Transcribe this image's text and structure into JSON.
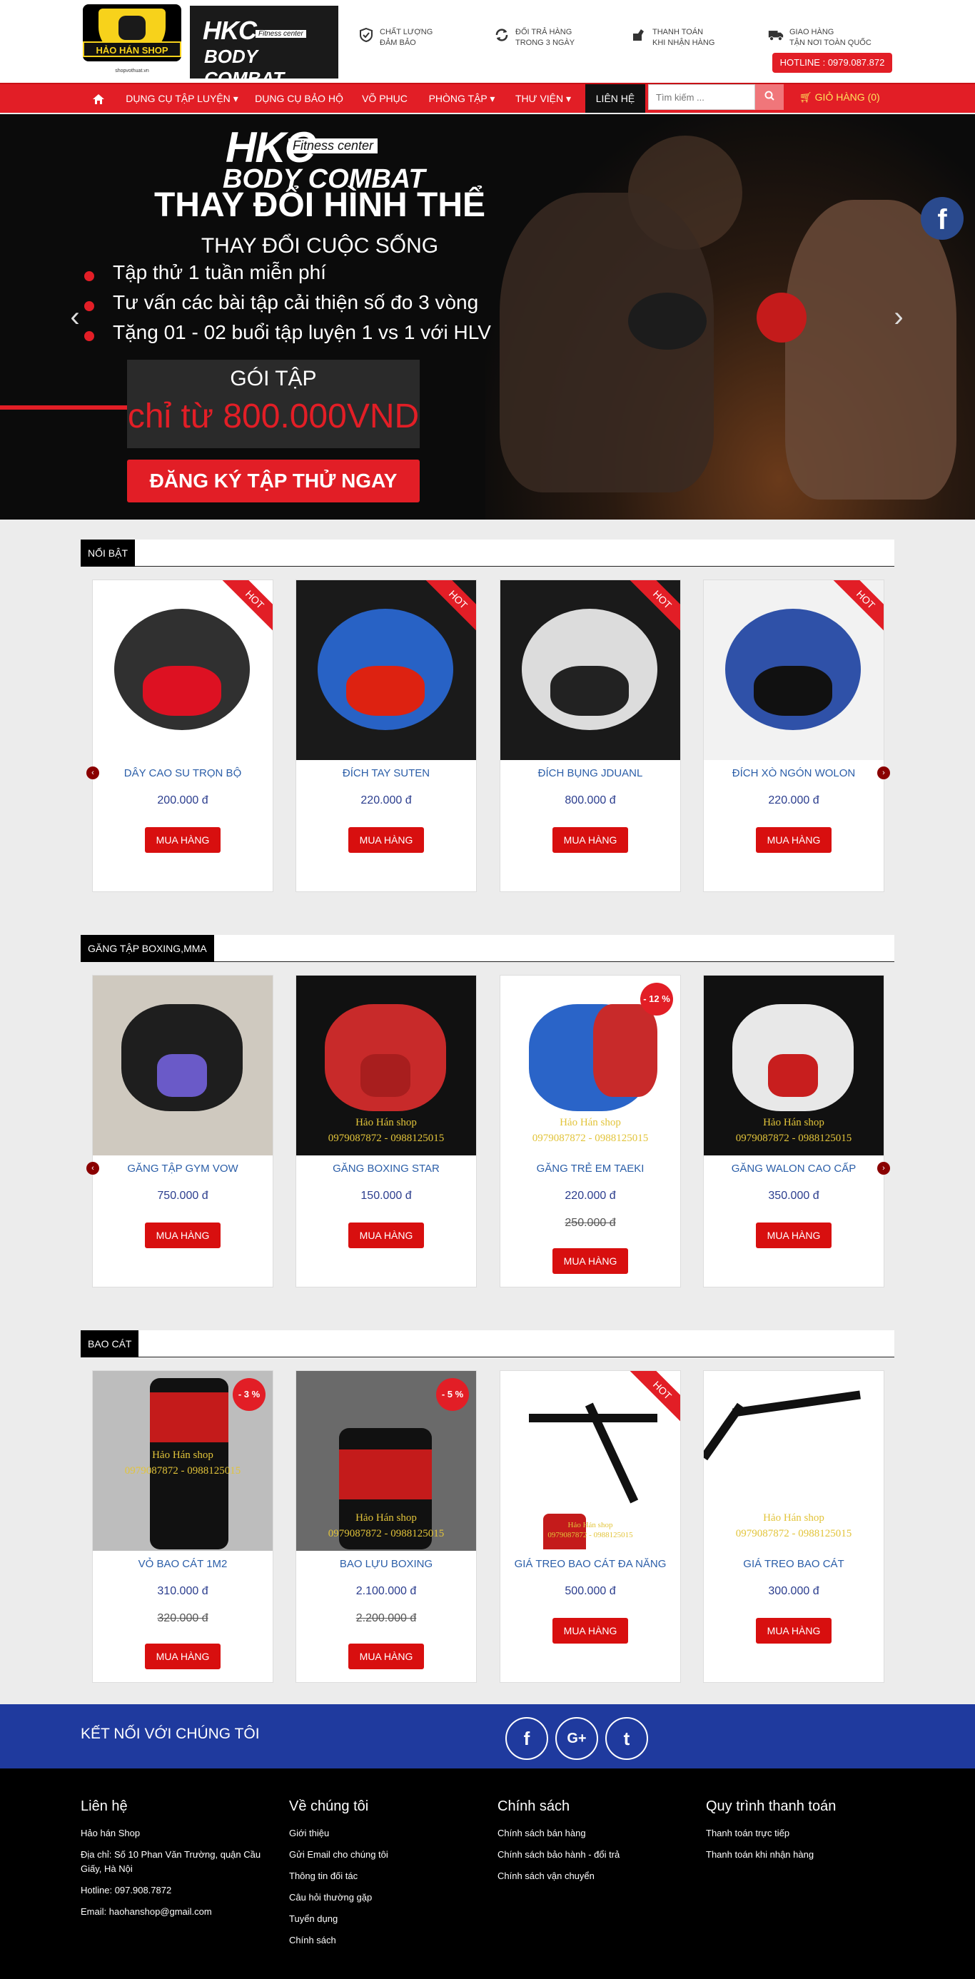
{
  "header": {
    "logo1_name": "HẢO HÁN SHOP",
    "logo1_sub": "shopvothuat.vn",
    "logo2_big": "HKC",
    "logo2_fit": "Fitness center",
    "logo2_bc": "BODY COMBAT",
    "features": [
      {
        "icon": "shield-icon",
        "line1": "Chất lượng",
        "line2": "đảm bảo"
      },
      {
        "icon": "refresh-icon",
        "line1": "Đổi trả hàng",
        "line2": "trong 3 ngày"
      },
      {
        "icon": "hand-cash-icon",
        "line1": "Thanh toán",
        "line2": "khi nhận hàng"
      },
      {
        "icon": "truck-icon",
        "line1": "Giao hàng",
        "line2": "tận nơi toàn quốc"
      }
    ],
    "hotline": "HOTLINE : 0979.087.872"
  },
  "nav": {
    "items": [
      "DỤNG CỤ TẬP LUYỆN",
      "DỤNG CỤ BẢO HỘ",
      "VÕ PHỤC",
      "PHÒNG TẬP",
      "THƯ VIỆN",
      "LIÊN HỆ"
    ],
    "search_placeholder": "Tìm kiếm ...",
    "cart": "GIỎ HÀNG (0)"
  },
  "banner": {
    "hkc": "HKC",
    "fit": "Fitness center",
    "bc": "BODY COMBAT",
    "h1": "THAY ĐỔI HÌNH THỂ",
    "h2": "THAY ĐỔI CUỘC SỐNG",
    "bullets": [
      "Tập thử 1 tuần miễn phí",
      "Tư vấn các bài tập cải thiện số đo 3 vòng",
      "Tặng 01 - 02 buổi tập luyện 1 vs 1 với HLV"
    ],
    "box_t1": "GÓI TẬP",
    "box_t2": "chỉ từ 800.000VND",
    "cta": "ĐĂNG KÝ TẬP THỬ NGAY"
  },
  "buy_label": "MUA HÀNG",
  "hot_label": "HOT",
  "watermark": [
    "Hảo Hán shop",
    "0979087872 - 0988125015"
  ],
  "sections": [
    {
      "title": "NỔI BẬT",
      "products": [
        {
          "name": "DÂY CAO SU TRỌN BỘ",
          "price": "200.000 đ",
          "old": "",
          "badge": "HOT"
        },
        {
          "name": "ĐÍCH TAY SUTEN",
          "price": "220.000 đ",
          "old": "",
          "badge": "HOT"
        },
        {
          "name": "ĐÍCH BỤNG JDUANL",
          "price": "800.000 đ",
          "old": "",
          "badge": "HOT"
        },
        {
          "name": "ĐÍCH XÒ NGÓN WOLON",
          "price": "220.000 đ",
          "old": "",
          "badge": "HOT"
        }
      ]
    },
    {
      "title": "GĂNG TẬP BOXING,MMA",
      "products": [
        {
          "name": "GĂNG TẬP GYM VOW",
          "price": "750.000 đ",
          "old": "",
          "badge": ""
        },
        {
          "name": "GĂNG BOXING STAR",
          "price": "150.000 đ",
          "old": "",
          "badge": ""
        },
        {
          "name": "GĂNG TRẺ EM TAEKI",
          "price": "220.000 đ",
          "old": "250.000 đ",
          "badge": "- 12 %"
        },
        {
          "name": "GĂNG WALON CAO CẤP",
          "price": "350.000 đ",
          "old": "",
          "badge": ""
        }
      ]
    },
    {
      "title": "BAO CÁT",
      "products": [
        {
          "name": "VỎ BAO CÁT 1M2",
          "price": "310.000 đ",
          "old": "320.000 đ",
          "badge": "- 3 %"
        },
        {
          "name": "BAO LỰU BOXING",
          "price": "2.100.000 đ",
          "old": "2.200.000 đ",
          "badge": "- 5 %"
        },
        {
          "name": "GIÁ TREO BAO CÁT ĐA NĂNG",
          "price": "500.000 đ",
          "old": "",
          "badge": "HOT"
        },
        {
          "name": "GIÁ TREO BAO CÁT",
          "price": "300.000 đ",
          "old": "",
          "badge": ""
        }
      ]
    }
  ],
  "connect": {
    "title": "KẾT NỐI VỚI CHÚNG TÔI",
    "icons": [
      "facebook-icon",
      "google-plus-icon",
      "twitter-icon"
    ],
    "icon_glyphs": [
      "f",
      "G+",
      "t"
    ]
  },
  "footer": {
    "cols": [
      {
        "title": "Liên hệ",
        "items": [
          "Hảo hán Shop",
          "Địa chỉ: Số 10 Phan Văn Trường, quận Cầu Giấy, Hà Nội",
          "Hotline: 097.908.7872",
          "Email: haohanshop@gmail.com"
        ]
      },
      {
        "title": "Về chúng tôi",
        "items": [
          "Giới thiệu",
          "Gửi Email cho chúng tôi",
          "Thông tin đối tác",
          "Câu hỏi thường gặp",
          "Tuyển dụng",
          "Chính sách"
        ]
      },
      {
        "title": "Chính sách",
        "items": [
          "Chính sách bán hàng",
          "Chính sách bảo hành - đổi trả",
          "Chính sách vận chuyển"
        ]
      },
      {
        "title": "Quy trình thanh toán",
        "items": [
          "Thanh toán trực tiếp",
          "Thanh toán khi nhận hàng"
        ]
      }
    ]
  },
  "colors": {
    "brand_red": "#e21e26",
    "nav_active": "#111111",
    "link_blue": "#2b5ea8",
    "connect_blue": "#1f3a9e"
  }
}
